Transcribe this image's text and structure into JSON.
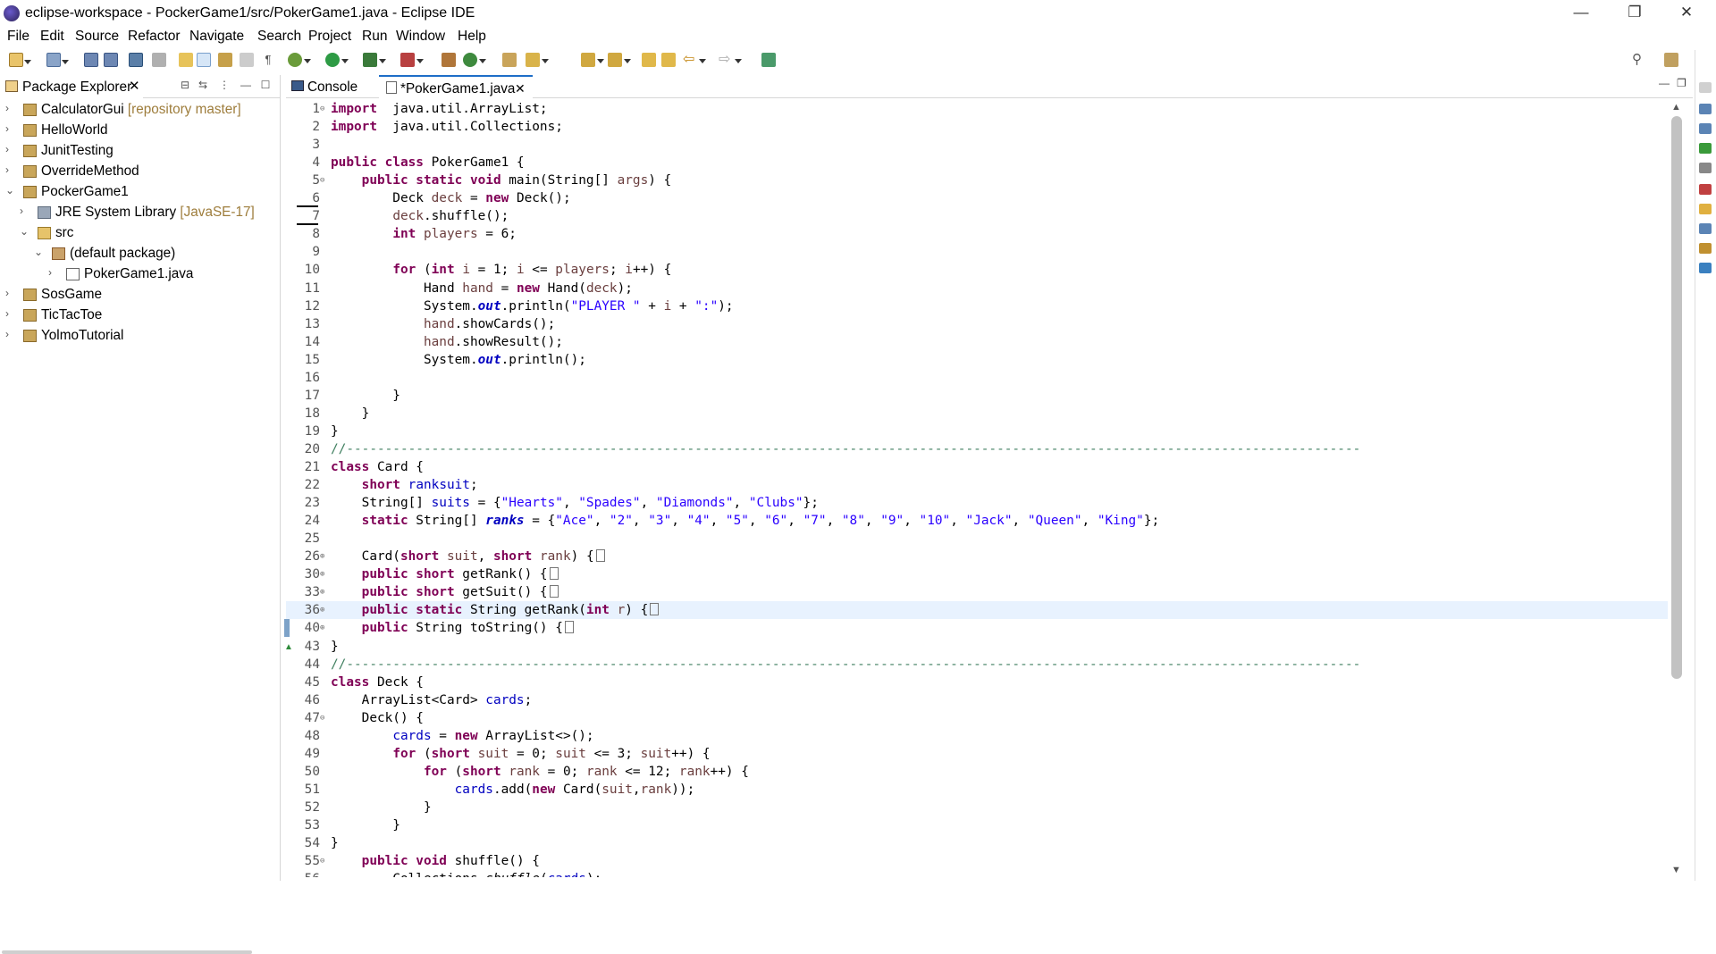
{
  "window": {
    "title": "eclipse-workspace - PockerGame1/src/PokerGame1.java - Eclipse IDE",
    "minimize": "—",
    "restore": "❐",
    "close": "✕"
  },
  "menu": [
    "File",
    "Edit",
    "Source",
    "Refactor",
    "Navigate",
    "Search",
    "Project",
    "Run",
    "Window",
    "Help"
  ],
  "package_explorer": {
    "tab_label": "Package Explorer",
    "tab_close": "✕",
    "items": [
      {
        "label": "CalculatorGui",
        "decor": " [repository master]",
        "arrow": "›",
        "icon": "project"
      },
      {
        "label": "HelloWorld",
        "decor": "",
        "arrow": "›",
        "icon": "project"
      },
      {
        "label": "JunitTesting",
        "decor": "",
        "arrow": "›",
        "icon": "project"
      },
      {
        "label": "OverrideMethod",
        "decor": "",
        "arrow": "›",
        "icon": "project"
      },
      {
        "label": "PockerGame1",
        "decor": "",
        "arrow": "⌄",
        "icon": "project"
      },
      {
        "label": "JRE System Library",
        "decor": " [JavaSE-17]",
        "arrow": "›",
        "icon": "library"
      },
      {
        "label": "src",
        "decor": "",
        "arrow": "⌄",
        "icon": "folder"
      },
      {
        "label": "(default package)",
        "decor": "",
        "arrow": "⌄",
        "icon": "package"
      },
      {
        "label": "PokerGame1.java",
        "decor": "",
        "arrow": "›",
        "icon": "java-file"
      },
      {
        "label": "SosGame",
        "decor": "",
        "arrow": "›",
        "icon": "project"
      },
      {
        "label": "TicTacToe",
        "decor": "",
        "arrow": "›",
        "icon": "project"
      },
      {
        "label": "YolmoTutorial",
        "decor": "",
        "arrow": "›",
        "icon": "project"
      }
    ]
  },
  "editor": {
    "tabs": [
      {
        "label": "Console",
        "active": false
      },
      {
        "label": "*PokerGame1.java",
        "active": true,
        "close": "✕"
      }
    ]
  },
  "code_lines": [
    {
      "n": "1",
      "fold": "⊖",
      "tokens": [
        [
          "kw",
          "import"
        ],
        [
          "",
          "  java.util.ArrayList;"
        ]
      ]
    },
    {
      "n": "2",
      "fold": "",
      "tokens": [
        [
          "kw",
          "import"
        ],
        [
          "",
          "  java.util.Collections;"
        ]
      ]
    },
    {
      "n": "3",
      "fold": "",
      "tokens": []
    },
    {
      "n": "4",
      "fold": "",
      "tokens": [
        [
          "kw",
          "public class"
        ],
        [
          "",
          " PokerGame1 {"
        ]
      ]
    },
    {
      "n": "5",
      "fold": "⊖",
      "tokens": [
        [
          "",
          "    "
        ],
        [
          "kw",
          "public static void"
        ],
        [
          "",
          " main(String[] "
        ],
        [
          "var",
          "args"
        ],
        [
          "",
          ") {"
        ]
      ]
    },
    {
      "n": "6",
      "fold": "",
      "tokens": [
        [
          "",
          "        Deck "
        ],
        [
          "var",
          "deck"
        ],
        [
          "",
          " = "
        ],
        [
          "kw",
          "new"
        ],
        [
          "",
          " Deck();"
        ]
      ]
    },
    {
      "n": "7",
      "fold": "",
      "tokens": [
        [
          "",
          "        "
        ],
        [
          "var",
          "deck"
        ],
        [
          "",
          ".shuffle();"
        ]
      ]
    },
    {
      "n": "8",
      "fold": "",
      "tokens": [
        [
          "",
          "        "
        ],
        [
          "kw",
          "int"
        ],
        [
          "",
          " "
        ],
        [
          "var",
          "players"
        ],
        [
          "",
          " = 6;"
        ]
      ]
    },
    {
      "n": "9",
      "fold": "",
      "tokens": []
    },
    {
      "n": "10",
      "fold": "",
      "tokens": [
        [
          "",
          "        "
        ],
        [
          "kw",
          "for"
        ],
        [
          "",
          " ("
        ],
        [
          "kw",
          "int"
        ],
        [
          "",
          " "
        ],
        [
          "var",
          "i"
        ],
        [
          "",
          " = 1; "
        ],
        [
          "var",
          "i"
        ],
        [
          "",
          " <= "
        ],
        [
          "var",
          "players"
        ],
        [
          "",
          "; "
        ],
        [
          "var",
          "i"
        ],
        [
          "",
          "++) {"
        ]
      ]
    },
    {
      "n": "11",
      "fold": "",
      "tokens": [
        [
          "",
          "            Hand "
        ],
        [
          "var",
          "hand"
        ],
        [
          "",
          " = "
        ],
        [
          "kw",
          "new"
        ],
        [
          "",
          " Hand("
        ],
        [
          "var",
          "deck"
        ],
        [
          "",
          ");"
        ]
      ]
    },
    {
      "n": "12",
      "fold": "",
      "tokens": [
        [
          "",
          "            System."
        ],
        [
          "sfld",
          "out"
        ],
        [
          "",
          ".println("
        ],
        [
          "str",
          "\"PLAYER \""
        ],
        [
          "",
          " + "
        ],
        [
          "var",
          "i"
        ],
        [
          "",
          " + "
        ],
        [
          "str",
          "\":\""
        ],
        [
          "",
          ");"
        ]
      ]
    },
    {
      "n": "13",
      "fold": "",
      "tokens": [
        [
          "",
          "            "
        ],
        [
          "var",
          "hand"
        ],
        [
          "",
          ".showCards();"
        ]
      ]
    },
    {
      "n": "14",
      "fold": "",
      "tokens": [
        [
          "",
          "            "
        ],
        [
          "var",
          "hand"
        ],
        [
          "",
          ".showResult();"
        ]
      ]
    },
    {
      "n": "15",
      "fold": "",
      "tokens": [
        [
          "",
          "            System."
        ],
        [
          "sfld",
          "out"
        ],
        [
          "",
          ".println();"
        ]
      ]
    },
    {
      "n": "16",
      "fold": "",
      "tokens": []
    },
    {
      "n": "17",
      "fold": "",
      "tokens": [
        [
          "",
          "        }"
        ]
      ]
    },
    {
      "n": "18",
      "fold": "",
      "tokens": [
        [
          "",
          "    }"
        ]
      ]
    },
    {
      "n": "19",
      "fold": "",
      "tokens": [
        [
          "",
          "}"
        ]
      ]
    },
    {
      "n": "20",
      "fold": "",
      "tokens": [
        [
          "cmt",
          "//-----------------------------------------------------------------------------------------------------------------------------------"
        ]
      ]
    },
    {
      "n": "21",
      "fold": "",
      "tokens": [
        [
          "kw",
          "class"
        ],
        [
          "",
          " Card {"
        ]
      ]
    },
    {
      "n": "22",
      "fold": "",
      "tokens": [
        [
          "",
          "    "
        ],
        [
          "kw",
          "short"
        ],
        [
          "",
          " "
        ],
        [
          "fld",
          "rank"
        ],
        [
          ", "
        ],
        [
          "fld",
          "suit"
        ],
        [
          "",
          ";"
        ]
      ]
    },
    {
      "n": "23",
      "fold": "",
      "tokens": [
        [
          "",
          "    String[] "
        ],
        [
          "fld",
          "suits"
        ],
        [
          "",
          " = {"
        ],
        [
          "str",
          "\"Hearts\""
        ],
        [
          "",
          ", "
        ],
        [
          "str",
          "\"Spades\""
        ],
        [
          "",
          ", "
        ],
        [
          "str",
          "\"Diamonds\""
        ],
        [
          "",
          ", "
        ],
        [
          "str",
          "\"Clubs\""
        ],
        [
          "",
          "};"
        ]
      ]
    },
    {
      "n": "24",
      "fold": "",
      "tokens": [
        [
          "",
          "    "
        ],
        [
          "kw",
          "static"
        ],
        [
          "",
          " String[] "
        ],
        [
          "sfld",
          "ranks"
        ],
        [
          "",
          " = {"
        ],
        [
          "str",
          "\"Ace\""
        ],
        [
          "",
          ", "
        ],
        [
          "str",
          "\"2\""
        ],
        [
          "",
          ", "
        ],
        [
          "str",
          "\"3\""
        ],
        [
          "",
          ", "
        ],
        [
          "str",
          "\"4\""
        ],
        [
          "",
          ", "
        ],
        [
          "str",
          "\"5\""
        ],
        [
          "",
          ", "
        ],
        [
          "str",
          "\"6\""
        ],
        [
          "",
          ", "
        ],
        [
          "str",
          "\"7\""
        ],
        [
          "",
          ", "
        ],
        [
          "str",
          "\"8\""
        ],
        [
          "",
          ", "
        ],
        [
          "str",
          "\"9\""
        ],
        [
          "",
          ", "
        ],
        [
          "str",
          "\"10\""
        ],
        [
          "",
          ", "
        ],
        [
          "str",
          "\"Jack\""
        ],
        [
          "",
          ", "
        ],
        [
          "str",
          "\"Queen\""
        ],
        [
          "",
          ", "
        ],
        [
          "str",
          "\"King\""
        ],
        [
          "",
          "};"
        ]
      ]
    },
    {
      "n": "25",
      "fold": "",
      "tokens": []
    },
    {
      "n": "26",
      "fold": "⊕",
      "tokens": [
        [
          "",
          "    Card("
        ],
        [
          "kw",
          "short"
        ],
        [
          "",
          " "
        ],
        [
          "var",
          "suit"
        ],
        [
          "",
          ", "
        ],
        [
          "kw",
          "short"
        ],
        [
          "",
          " "
        ],
        [
          "var",
          "rank"
        ],
        [
          "",
          ") {"
        ],
        [
          "box",
          ""
        ]
      ]
    },
    {
      "n": "30",
      "fold": "⊕",
      "tokens": [
        [
          "",
          "    "
        ],
        [
          "kw",
          "public short"
        ],
        [
          "",
          " getRank() {"
        ],
        [
          "box",
          ""
        ]
      ]
    },
    {
      "n": "33",
      "fold": "⊕",
      "tokens": [
        [
          "",
          "    "
        ],
        [
          "kw",
          "public short"
        ],
        [
          "",
          " getSuit() {"
        ],
        [
          "box",
          ""
        ]
      ]
    },
    {
      "n": "36",
      "fold": "⊕",
      "tokens": [
        [
          "",
          "    "
        ],
        [
          "kw",
          "public static"
        ],
        [
          "",
          " String getRank("
        ],
        [
          "kw",
          "int"
        ],
        [
          "",
          " "
        ],
        [
          "var",
          "r"
        ],
        [
          "",
          ") {"
        ],
        [
          "box",
          ""
        ]
      ]
    },
    {
      "n": "40",
      "fold": "⊕",
      "tokens": [
        [
          "",
          "    "
        ],
        [
          "kw",
          "public"
        ],
        [
          "",
          " String toString() {"
        ],
        [
          "box",
          ""
        ]
      ]
    },
    {
      "n": "43",
      "fold": "",
      "tokens": [
        [
          "",
          "}"
        ]
      ]
    },
    {
      "n": "44",
      "fold": "",
      "tokens": [
        [
          "cmt",
          "//-----------------------------------------------------------------------------------------------------------------------------------"
        ]
      ]
    },
    {
      "n": "45",
      "fold": "",
      "tokens": [
        [
          "kw",
          "class"
        ],
        [
          "",
          " Deck {"
        ]
      ]
    },
    {
      "n": "46",
      "fold": "",
      "tokens": [
        [
          "",
          "    ArrayList<Card> "
        ],
        [
          "fld",
          "cards"
        ],
        [
          "",
          ";"
        ]
      ]
    },
    {
      "n": "47",
      "fold": "⊖",
      "tokens": [
        [
          "",
          "    Deck() {"
        ]
      ]
    },
    {
      "n": "48",
      "fold": "",
      "tokens": [
        [
          "",
          "        "
        ],
        [
          "fld",
          "cards"
        ],
        [
          "",
          " = "
        ],
        [
          "kw",
          "new"
        ],
        [
          "",
          " ArrayList<>();"
        ]
      ]
    },
    {
      "n": "49",
      "fold": "",
      "tokens": [
        [
          "",
          "        "
        ],
        [
          "kw",
          "for"
        ],
        [
          "",
          " ("
        ],
        [
          "kw",
          "short"
        ],
        [
          "",
          " "
        ],
        [
          "var",
          "suit"
        ],
        [
          "",
          " = 0; "
        ],
        [
          "var",
          "suit"
        ],
        [
          "",
          " <= 3; "
        ],
        [
          "var",
          "suit"
        ],
        [
          "",
          "++) {"
        ]
      ]
    },
    {
      "n": "50",
      "fold": "",
      "tokens": [
        [
          "",
          "            "
        ],
        [
          "kw",
          "for"
        ],
        [
          "",
          " ("
        ],
        [
          "kw",
          "short"
        ],
        [
          "",
          " "
        ],
        [
          "var",
          "rank"
        ],
        [
          "",
          " = 0; "
        ],
        [
          "var",
          "rank"
        ],
        [
          "",
          " <= 12; "
        ],
        [
          "var",
          "rank"
        ],
        [
          "",
          "++) {"
        ]
      ]
    },
    {
      "n": "51",
      "fold": "",
      "tokens": [
        [
          "",
          "                "
        ],
        [
          "fld",
          "cards"
        ],
        [
          "",
          ".add("
        ],
        [
          "kw",
          "new"
        ],
        [
          "",
          " Card("
        ],
        [
          "var",
          "suit"
        ],
        [
          "",
          ","
        ],
        [
          "var",
          "rank"
        ],
        [
          "",
          "));"
        ]
      ]
    },
    {
      "n": "52",
      "fold": "",
      "tokens": [
        [
          "",
          "            }"
        ]
      ]
    },
    {
      "n": "53",
      "fold": "",
      "tokens": [
        [
          "",
          "        }"
        ]
      ]
    },
    {
      "n": "54",
      "fold": "",
      "tokens": [
        [
          "",
          "}"
        ]
      ]
    },
    {
      "n": "55",
      "fold": "⊖",
      "tokens": [
        [
          "",
          "    "
        ],
        [
          "kw",
          "public void"
        ],
        [
          "",
          " shuffle() {"
        ]
      ]
    },
    {
      "n": "56",
      "fold": "",
      "tokens": [
        [
          "",
          "        Collections."
        ],
        [
          "ital",
          "shuffle"
        ],
        [
          "",
          "("
        ],
        [
          "fld",
          "cards"
        ],
        [
          "",
          ");"
        ]
      ]
    }
  ]
}
